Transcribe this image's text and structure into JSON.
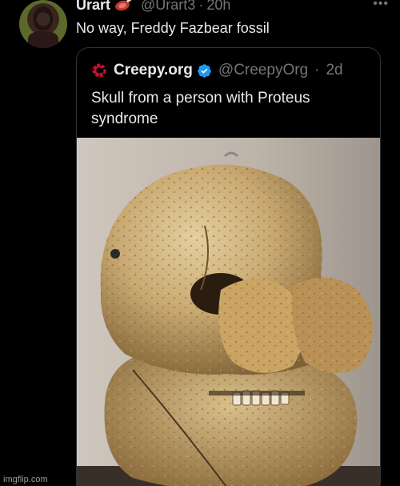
{
  "post": {
    "display_name": "Urart",
    "handle": "@Urart3",
    "separator": "·",
    "time": "20h",
    "text": "No way, Freddy Fazbear fossil",
    "more_icon": "more-horizontal-icon",
    "name_emoji": "meat-icon"
  },
  "quote": {
    "display_name": "Creepy.org",
    "handle": "@CreepyOrg",
    "separator": "·",
    "time": "2d",
    "text": "Skull from a person with Proteus syndrome",
    "verified_icon": "verified-badge-icon",
    "logo_icon": "creepy-logo-icon",
    "verified_color": "#1d9bf0",
    "logo_color": "#c8102e"
  },
  "watermark": "imgflip.com",
  "colors": {
    "background": "#000000",
    "text": "#e7e9ea",
    "muted": "#71767b",
    "border": "#2f3336"
  }
}
